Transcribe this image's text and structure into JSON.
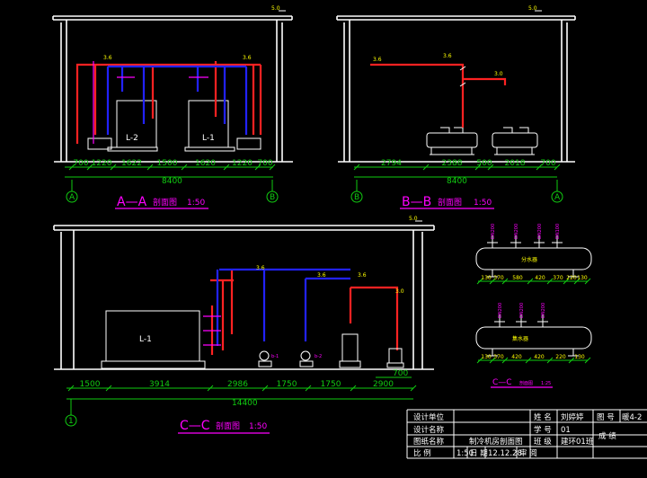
{
  "colors": {
    "background": "#000000",
    "wall": "#ffffff",
    "supply_pipe": "#ff2222",
    "return_pipe": "#2222ff",
    "dimension": "#11cc11",
    "title": "#ff00ff",
    "label": "#ffff00"
  },
  "views": {
    "aa": {
      "title": "A—A",
      "subtitle": "剖面图",
      "scale": "1:50",
      "grid_left": "A",
      "grid_right": "B",
      "height_mark": "5.0",
      "units": [
        "L-2",
        "L-1"
      ],
      "elev_marks": [
        "3.6",
        "3.6"
      ],
      "dims": [
        "700",
        "1220",
        "1622",
        "1500",
        "1620",
        "1220",
        "700"
      ],
      "total": "8400"
    },
    "bb": {
      "title": "B—B",
      "subtitle": "剖面图",
      "scale": "1:50",
      "grid_left": "B",
      "grid_right": "A",
      "height_mark": "5.0",
      "elev_marks": [
        "3.6",
        "3.6",
        "3.0"
      ],
      "dims": [
        "2794",
        "2388",
        "500",
        "2018",
        "700"
      ],
      "total": "8400"
    },
    "cc": {
      "title": "C—C",
      "subtitle": "剖面图",
      "scale": "1:50",
      "grid_left": "1",
      "height_mark": "5.0",
      "unit": "L-1",
      "pumps": [
        "b-1",
        "b-2"
      ],
      "elev_marks": [
        "3.6",
        "3.6",
        "3.6",
        "3.0"
      ],
      "dims": [
        "1500",
        "3914",
        "2986",
        "1750",
        "1750",
        "2900"
      ],
      "dim_upper": "700",
      "total": "14400"
    },
    "header_detail": {
      "title": "C—C",
      "subtitle": "剖面图",
      "scale": "1:25",
      "top_label": "分水器",
      "bottom_label": "集水器",
      "top_pipes": [
        "DN200",
        "DN200",
        "DN200",
        "DN100"
      ],
      "bottom_pipes": [
        "DN200",
        "DN200",
        "DN200"
      ],
      "top_dims": [
        "130",
        "370",
        "580",
        "420",
        "370",
        "220",
        "130"
      ],
      "bottom_dims": [
        "130",
        "370",
        "420",
        "420",
        "220",
        "130"
      ]
    }
  },
  "title_block": {
    "design_unit_label": "设计单位",
    "project_name_label": "设计名称",
    "drawing_name_label": "图纸名称",
    "drawing_name_value": "制冷机房剖面图",
    "scale_label": "比 例",
    "scale_value": "1:50",
    "date_label": "日 期",
    "date_value": "12.12.28",
    "review_label": "审 阅",
    "name_label": "姓 名",
    "name_value": "刘婷婷",
    "drawing_no_label": "图 号",
    "drawing_no_value": "暖4-2",
    "student_no_label": "学 号",
    "student_no_value": "01",
    "class_label": "班 级",
    "class_value": "建环01班",
    "grade_label": "成 绩"
  }
}
